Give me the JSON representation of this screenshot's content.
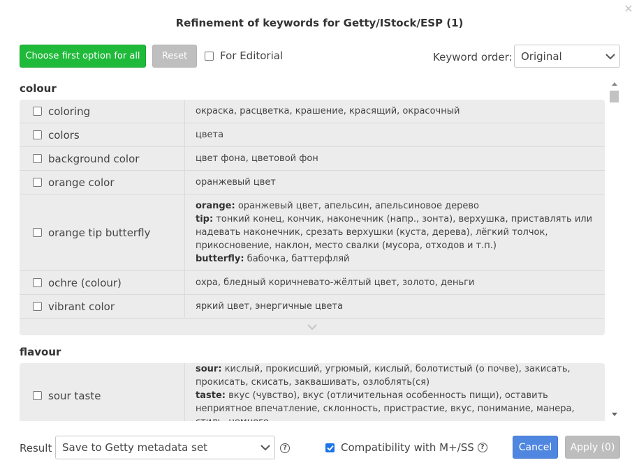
{
  "dialog": {
    "title": "Refinement of keywords for Getty/IStock/ESP (1)",
    "close_icon": "close-icon"
  },
  "toolbar": {
    "choose_first_label": "Choose first option for all",
    "reset_label": "Reset",
    "editorial_label": "For Editorial",
    "editorial_checked": false,
    "keyword_order_label": "Keyword order:",
    "keyword_order_value": "Original"
  },
  "groups": [
    {
      "name": "colour",
      "rows": [
        {
          "keyword": "coloring",
          "translation": "окраска, расцветка, крашение, красящий, окрасочный"
        },
        {
          "keyword": "colors",
          "translation": "цвета"
        },
        {
          "keyword": "background color",
          "translation": "цвет фона, цветовой фон"
        },
        {
          "keyword": "orange color",
          "translation": "оранжевый цвет"
        },
        {
          "keyword": "orange tip butterfly",
          "terms": [
            {
              "term": "orange:",
              "text": "оранжевый цвет, апельсин, апельсиновое дерево"
            },
            {
              "term": "tip:",
              "text": "тонкий конец, кончик, наконечник (напр., зонта), верхушка, приставлять или надевать наконечник, срезать верхушки (куста, дерева), лёгкий толчок, прикосновение, наклон, место свалки (мусора, отходов и т.п.)"
            },
            {
              "term": "butterfly:",
              "text": "бабочка, баттерфляй"
            }
          ]
        },
        {
          "keyword": "ochre (colour)",
          "translation": "охра, бледный коричневато-жёлтый цвет, золото, деньги"
        },
        {
          "keyword": "vibrant color",
          "translation": "яркий цвет, энергичные цвета"
        }
      ]
    },
    {
      "name": "flavour",
      "rows": [
        {
          "keyword": "sour taste",
          "terms": [
            {
              "term": "sour:",
              "text": "кислый, прокисший, угрюмый, кислый, болотистый (о почве), закисать, прокисать, скисать, заквашивать, озлоблять(ся)"
            },
            {
              "term": "taste:",
              "text": "вкус (чувство), вкус (отличительная особенность пищи), оставить неприятное впечатление, склонность, пристрастие, вкус, понимание, манера, стиль, немного"
            }
          ]
        }
      ]
    }
  ],
  "footer": {
    "result_label": "Result",
    "result_value": "Save to Getty metadata set",
    "compat_label": "Compatibility with M+/SS",
    "compat_checked": true,
    "cancel_label": "Cancel",
    "apply_label": "Apply (0)"
  },
  "colors": {
    "green": "#1fba3a",
    "blue": "#4f86e0",
    "disabled": "#bdbdbd",
    "row_bg": "#ececec"
  }
}
